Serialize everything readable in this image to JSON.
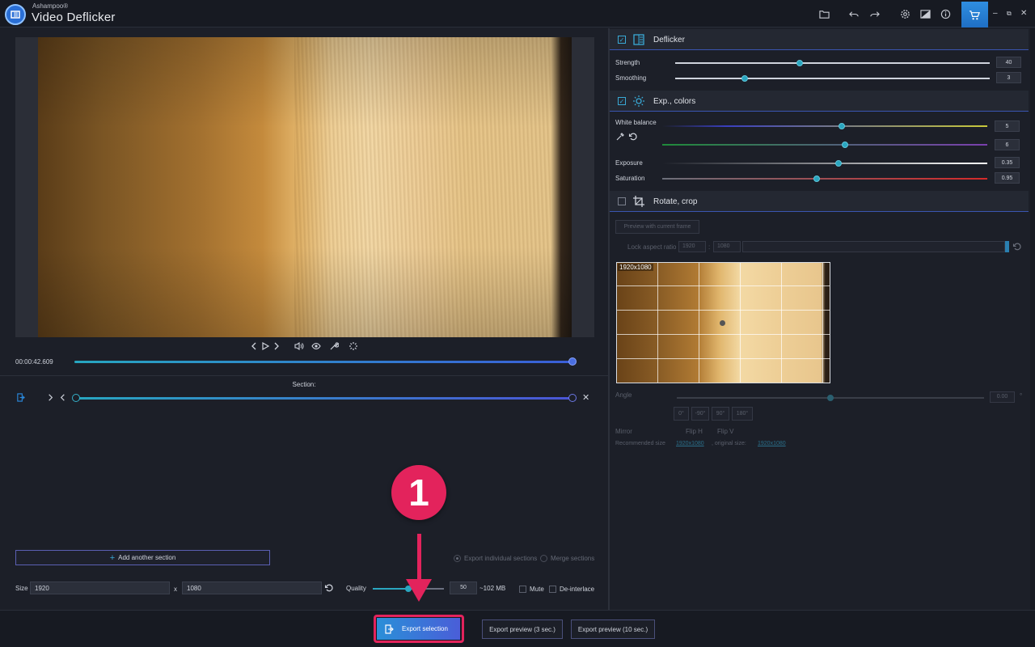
{
  "app": {
    "brand": "Ashampoo®",
    "name": "Video Deflicker"
  },
  "player": {
    "timecode": "00:00:42.609"
  },
  "section": {
    "label": "Section:",
    "add_label": "Add another section",
    "export_individual": "Export individual sections",
    "merge": "Merge sections"
  },
  "output": {
    "size_label": "Size",
    "width": "1920",
    "height": "1080",
    "x_label": "x",
    "quality_label": "Quality",
    "quality_value": "50",
    "filesize": "~102 MB",
    "mute": "Mute",
    "deinterlace": "De-interlace"
  },
  "bottom": {
    "export_selection": "Export selection",
    "preview3": "Export preview (3 sec.)",
    "preview10": "Export preview (10 sec.)"
  },
  "annotation": {
    "step": "1"
  },
  "deflicker": {
    "title": "Deflicker",
    "strength_label": "Strength",
    "strength": "40",
    "smoothing_label": "Smoothing",
    "smoothing": "3"
  },
  "exposure": {
    "title": "Exp., colors",
    "wb_label": "White balance",
    "wb1": "5",
    "wb2": "6",
    "exposure_label": "Exposure",
    "exposure": "0.35",
    "saturation_label": "Saturation",
    "saturation": "0.95"
  },
  "rotate": {
    "title": "Rotate, crop",
    "preview_btn": "Preview with current frame",
    "lock_label": "Lock aspect ratio",
    "w": "1920",
    "colon": ":",
    "h": "1080",
    "thumb_caption": "1920x1080",
    "angle_label": "Angle",
    "angle_value": "0.00",
    "deg_sign": "°",
    "angles": [
      "0°",
      "-90°",
      "90°",
      "180°"
    ],
    "mirror_label": "Mirror",
    "flip_h": "Flip H",
    "flip_v": "Flip V",
    "rec_label": "Recommended size",
    "rec_value": "1920x1080",
    "orig_label": ", original size:",
    "orig_value": "1920x1080"
  },
  "colors": {
    "accent": "#2aa6c0",
    "highlight": "#e3235c",
    "panel_line": "#3a55b0"
  }
}
